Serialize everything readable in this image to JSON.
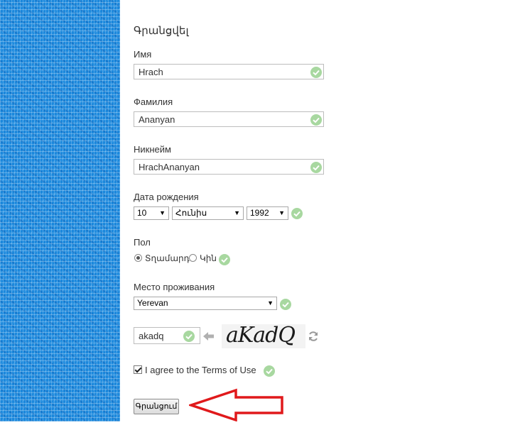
{
  "form": {
    "title": "Գրանցվել",
    "first_name": {
      "label": "Имя",
      "value": "Hrach"
    },
    "last_name": {
      "label": "Фамилия",
      "value": "Ananyan"
    },
    "nickname": {
      "label": "Никнейм",
      "value": "HrachAnanyan"
    },
    "birth_date": {
      "label": "Дата рождения",
      "day": "10",
      "month": "Հունիս",
      "year": "1992"
    },
    "gender": {
      "label": "Пол",
      "options": [
        "Տղամարդ",
        "Կին"
      ],
      "selected": "Տղամարդ"
    },
    "residence": {
      "label": "Место проживания",
      "value": "Yerevan"
    },
    "captcha": {
      "input_value": "akadq",
      "image_text": "aKadQ"
    },
    "terms": {
      "checked": true,
      "label": "I agree to the Terms of Use"
    },
    "submit_label": "Գրանցում"
  },
  "colors": {
    "sidebar": "#1b88dc",
    "valid_check": "#a8d8a0",
    "arrow": "#e0191b"
  },
  "icons": [
    "check-circle-icon",
    "arrow-left-icon",
    "refresh-icon",
    "arrow-annotation-icon"
  ]
}
